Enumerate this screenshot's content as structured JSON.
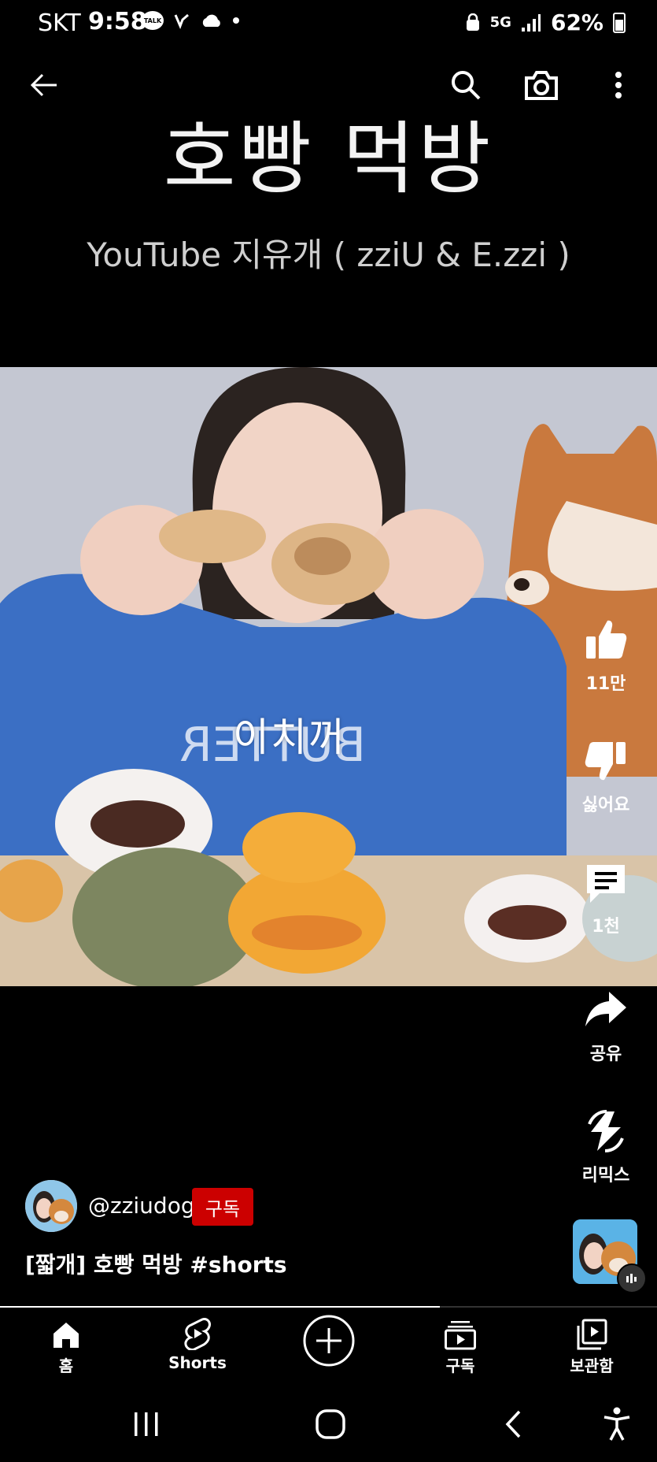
{
  "status_bar": {
    "carrier": "SKT",
    "time": "9:58",
    "network": "5G",
    "battery": "62%"
  },
  "video": {
    "title_card": "호빵 먹방",
    "subtitle_card": "YouTube 지유개 ( zziU & E.zzi )",
    "caption": "이치꺼"
  },
  "actions": {
    "like_count": "11만",
    "dislike_label": "싫어요",
    "comment_count": "1천",
    "share_label": "공유",
    "remix_label": "리믹스"
  },
  "channel": {
    "handle": "@zziudog",
    "subscribe_label": "구독"
  },
  "short": {
    "title": "[짧개] 호빵 먹방 #shorts"
  },
  "progress": 0.67,
  "nav": {
    "home": "홈",
    "shorts": "Shorts",
    "subscriptions": "구독",
    "library": "보관함"
  },
  "colors": {
    "subscribe": "#cc0000",
    "sweater": "#3b6fc4",
    "dog": "#c9793e"
  },
  "icons": [
    "back-arrow-icon",
    "search-icon",
    "camera-icon",
    "more-vert-icon",
    "thumbs-up-icon",
    "thumbs-down-icon",
    "comment-icon",
    "share-icon",
    "remix-icon",
    "home-icon",
    "shorts-icon",
    "create-icon",
    "subscriptions-icon",
    "library-icon"
  ]
}
